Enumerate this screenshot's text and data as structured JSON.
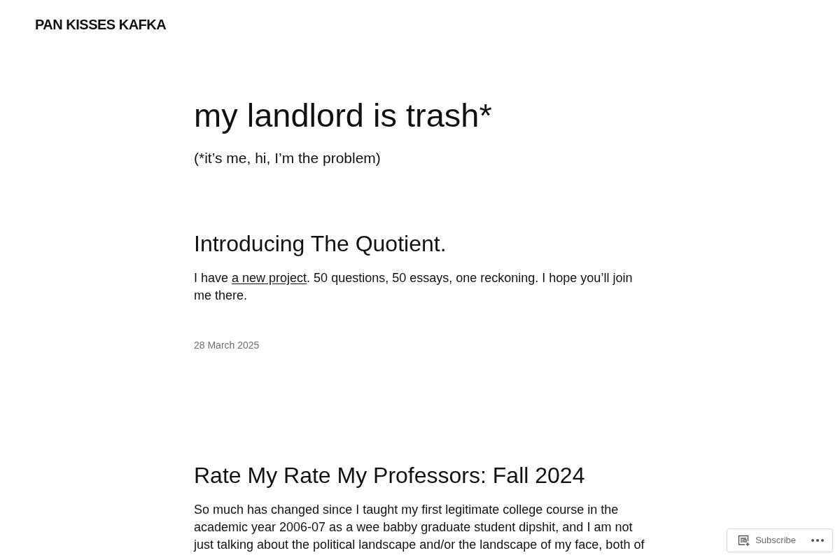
{
  "site_title": "PAN KISSES KAFKA",
  "blog": {
    "title": "my landlord is trash*",
    "tagline": "(*it’s me, hi, I’m the problem)"
  },
  "posts": [
    {
      "title": "Introducing The Quotient.",
      "excerpt": [
        {
          "kind": "text",
          "text": "I have "
        },
        {
          "kind": "link",
          "text": "a new project"
        },
        {
          "kind": "text",
          "text": ". 50 questions, 50 essays, one reckoning. I hope you’ll join me there."
        }
      ],
      "date": "28 March 2025"
    },
    {
      "title": "Rate My Rate My Professors: Fall 2024",
      "excerpt": [
        {
          "kind": "text",
          "text": "So much has changed since I taught my first legitimate college course in the academic year 2006-07 as a wee babby graduate student dipshit, and I am not just talking about the political landscape and/or the landscape of my face, both of"
        }
      ]
    }
  ],
  "subscribe_bar": {
    "button": "Subscribe"
  }
}
